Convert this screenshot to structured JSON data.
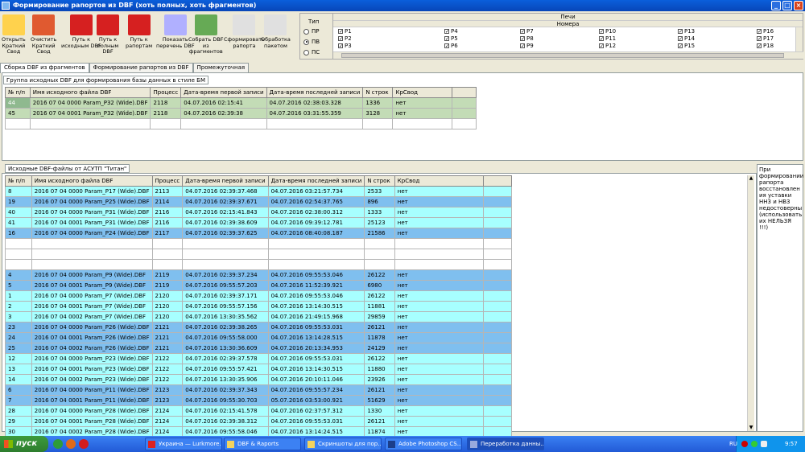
{
  "window": {
    "title": "Формирование рапортов из DBF (хоть полных, хоть фрагментов)"
  },
  "toolbar": [
    {
      "label": "Открыть\nКраткий\nСвод",
      "icon": "open-summary-icon"
    },
    {
      "label": "Очистить\nКраткий\nСвод",
      "icon": "clear-summary-icon"
    },
    {
      "label": "Путь к\nисходным DBF",
      "icon": "dbf-source-path-icon"
    },
    {
      "label": "Путь к\nполным\nDBF",
      "icon": "dbf-full-path-icon"
    },
    {
      "label": "Путь к\nрапортам",
      "icon": "reports-path-icon"
    },
    {
      "label": "Показать\nперечень DBF",
      "icon": "show-dbf-list-icon"
    },
    {
      "label": "Собрать DBF\nиз\nфрагментов",
      "icon": "assemble-dbf-icon"
    },
    {
      "label": "Сформировать\nрапорта",
      "icon": "form-reports-icon"
    },
    {
      "label": "Обработка\nпакетом",
      "icon": "batch-processing-icon"
    }
  ],
  "tip": {
    "label": "Тип",
    "options": [
      "ПР",
      "ПВ",
      "ПС"
    ],
    "selected": "ПВ"
  },
  "pechi": {
    "title": "Печи",
    "subtitle": "Номера",
    "columns": [
      [
        "P1",
        "P2",
        "P3"
      ],
      [
        "P4",
        "P5",
        "P6"
      ],
      [
        "P7",
        "P8",
        "P9"
      ],
      [
        "P10",
        "P11",
        "P12"
      ],
      [
        "P13",
        "P14",
        "P15"
      ],
      [
        "P16",
        "P17",
        "P18"
      ]
    ]
  },
  "tabs": [
    "Сборка DBF из фрагментов",
    "Формирование рапортов из DBF",
    "Промежуточная"
  ],
  "group1": {
    "title": "Группа исходных DBF для формирования базы данных в стиле БМ",
    "headers": [
      "№ п/п",
      "Имя исходного файла DBF",
      "Процесс",
      "Дата-время первой записи",
      "Дата-время последней записи",
      "N строк",
      "КрСвод"
    ],
    "rows": [
      [
        "44",
        "2016 07 04 0000 Param_P32 (Wide).DBF",
        "2118",
        "04.07.2016 02:15:41",
        "04.07.2016 02:38:03.328",
        "1336",
        "нет"
      ],
      [
        "45",
        "2016 07 04 0001 Param_P32 (Wide).DBF",
        "2118",
        "04.07.2016 02:39:38",
        "04.07.2016 03:31:55.359",
        "3128",
        "нет"
      ]
    ]
  },
  "group2": {
    "title": "Исходные DBF-файлы от АСУТП \"Титан\"",
    "headers": [
      "№ п/п",
      "Имя исходного файла DBF",
      "Процесс",
      "Дата-время первой записи",
      "Дата-время последней записи",
      "N строк",
      "КрСвод"
    ],
    "rows": [
      {
        "c": "cyan",
        "v": [
          "8",
          "2016 07 04 0000 Param_P17 (Wide).DBF",
          "2113",
          "04.07.2016 02:39:37.468",
          "04.07.2016 03:21:57.734",
          "2533",
          "нет"
        ]
      },
      {
        "c": "blue",
        "v": [
          "19",
          "2016 07 04 0000 Param_P25 (Wide).DBF",
          "2114",
          "04.07.2016 02:39:37.671",
          "04.07.2016 02:54:37.765",
          "896",
          "нет"
        ]
      },
      {
        "c": "cyan",
        "v": [
          "40",
          "2016 07 04 0000 Param_P31 (Wide).DBF",
          "2116",
          "04.07.2016 02:15:41.843",
          "04.07.2016 02:38:00.312",
          "1333",
          "нет"
        ]
      },
      {
        "c": "cyan",
        "v": [
          "41",
          "2016 07 04 0001 Param_P31 (Wide).DBF",
          "2116",
          "04.07.2016 02:39:38.609",
          "04.07.2016 09:39:12.781",
          "25123",
          "нет"
        ]
      },
      {
        "c": "blue",
        "v": [
          "16",
          "2016 07 04 0000 Param_P24 (Wide).DBF",
          "2117",
          "04.07.2016 02:39:37.625",
          "04.07.2016 08:40:08.187",
          "21586",
          "нет"
        ]
      },
      {
        "c": "white",
        "v": [
          "",
          "",
          "",
          "",
          "",
          "",
          ""
        ]
      },
      {
        "c": "white",
        "v": [
          "",
          "",
          "",
          "",
          "",
          "",
          ""
        ]
      },
      {
        "c": "white",
        "v": [
          "",
          "",
          "",
          "",
          "",
          "",
          ""
        ]
      },
      {
        "c": "blue",
        "v": [
          "4",
          "2016 07 04 0000 Param_P9 (Wide).DBF",
          "2119",
          "04.07.2016 02:39:37.234",
          "04.07.2016 09:55:53.046",
          "26122",
          "нет"
        ]
      },
      {
        "c": "blue",
        "v": [
          "5",
          "2016 07 04 0001 Param_P9 (Wide).DBF",
          "2119",
          "04.07.2016 09:55:57.203",
          "04.07.2016 11:52:39.921",
          "6980",
          "нет"
        ]
      },
      {
        "c": "cyan",
        "v": [
          "1",
          "2016 07 04 0000 Param_P7 (Wide).DBF",
          "2120",
          "04.07.2016 02:39:37.171",
          "04.07.2016 09:55:53.046",
          "26122",
          "нет"
        ]
      },
      {
        "c": "cyan",
        "v": [
          "2",
          "2016 07 04 0001 Param_P7 (Wide).DBF",
          "2120",
          "04.07.2016 09:55:57.156",
          "04.07.2016 13:14:30.515",
          "11881",
          "нет"
        ]
      },
      {
        "c": "cyan",
        "v": [
          "3",
          "2016 07 04 0002 Param_P7 (Wide).DBF",
          "2120",
          "04.07.2016 13:30:35.562",
          "04.07.2016 21:49:15.968",
          "29859",
          "нет"
        ]
      },
      {
        "c": "blue",
        "v": [
          "23",
          "2016 07 04 0000 Param_P26 (Wide).DBF",
          "2121",
          "04.07.2016 02:39:38.265",
          "04.07.2016 09:55:53.031",
          "26121",
          "нет"
        ]
      },
      {
        "c": "blue",
        "v": [
          "24",
          "2016 07 04 0001 Param_P26 (Wide).DBF",
          "2121",
          "04.07.2016 09:55:58.000",
          "04.07.2016 13:14:28.515",
          "11878",
          "нет"
        ]
      },
      {
        "c": "blue",
        "v": [
          "25",
          "2016 07 04 0002 Param_P26 (Wide).DBF",
          "2121",
          "04.07.2016 13:30:36.609",
          "04.07.2016 20:13:34.953",
          "24129",
          "нет"
        ]
      },
      {
        "c": "cyan",
        "v": [
          "12",
          "2016 07 04 0000 Param_P23 (Wide).DBF",
          "2122",
          "04.07.2016 02:39:37.578",
          "04.07.2016 09:55:53.031",
          "26122",
          "нет"
        ]
      },
      {
        "c": "cyan",
        "v": [
          "13",
          "2016 07 04 0001 Param_P23 (Wide).DBF",
          "2122",
          "04.07.2016 09:55:57.421",
          "04.07.2016 13:14:30.515",
          "11880",
          "нет"
        ]
      },
      {
        "c": "cyan",
        "v": [
          "14",
          "2016 07 04 0002 Param_P23 (Wide).DBF",
          "2122",
          "04.07.2016 13:30:35.906",
          "04.07.2016 20:10:11.046",
          "23926",
          "нет"
        ]
      },
      {
        "c": "blue",
        "v": [
          "6",
          "2016 07 04 0000 Param_P11 (Wide).DBF",
          "2123",
          "04.07.2016 02:39:37.343",
          "04.07.2016 09:55:57.234",
          "26121",
          "нет"
        ]
      },
      {
        "c": "blue",
        "v": [
          "7",
          "2016 07 04 0001 Param_P11 (Wide).DBF",
          "2123",
          "04.07.2016 09:55:30.703",
          "05.07.2016 03:53:00.921",
          "51629",
          "нет"
        ]
      },
      {
        "c": "cyan",
        "v": [
          "28",
          "2016 07 04 0000 Param_P28 (Wide).DBF",
          "2124",
          "04.07.2016 02:15:41.578",
          "04.07.2016 02:37:57.312",
          "1330",
          "нет"
        ]
      },
      {
        "c": "cyan",
        "v": [
          "29",
          "2016 07 04 0001 Param_P28 (Wide).DBF",
          "2124",
          "04.07.2016 02:39:38.312",
          "04.07.2016 09:55:53.031",
          "26121",
          "нет"
        ]
      },
      {
        "c": "cyan",
        "v": [
          "30",
          "2016 07 04 0002 Param_P28 (Wide).DBF",
          "2124",
          "04.07.2016 09:55:58.046",
          "04.07.2016 13:14:24.515",
          "11874",
          "нет"
        ]
      }
    ]
  },
  "note": "При формировании рапорта восстановлен ия уставки НН3 и НВ3 недостоверны (использовать их НЕЛЬЗЯ !!!)",
  "taskbar": {
    "start": "пуск",
    "tasks": [
      {
        "label": "Украина — Lurkmore...",
        "icon": "opera-icon"
      },
      {
        "label": "DBF & Raports",
        "icon": "folder-icon"
      },
      {
        "label": "Скриншоты для пор...",
        "icon": "folder-icon"
      },
      {
        "label": "Adobe Photoshop CS...",
        "icon": "photoshop-icon"
      },
      {
        "label": "Переработка данны...",
        "icon": "app-icon"
      }
    ],
    "lang": "RU",
    "time": "9:57"
  }
}
